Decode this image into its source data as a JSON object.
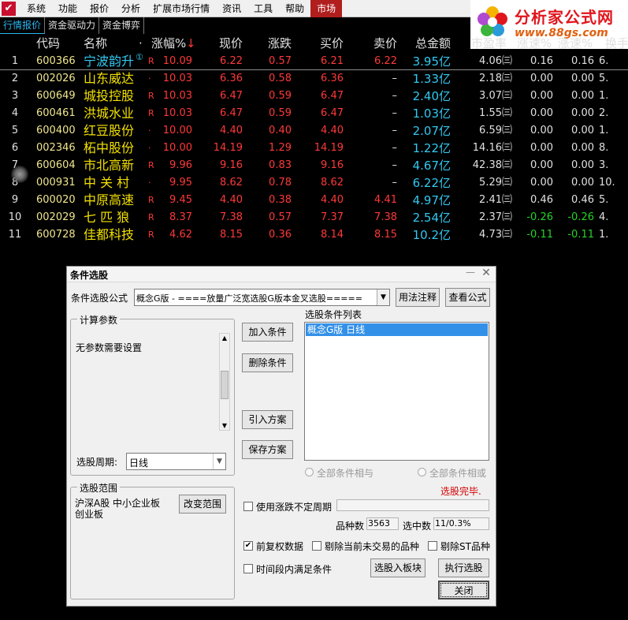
{
  "menu": {
    "app_icon": "app-logo-icon",
    "items": [
      "系统",
      "功能",
      "报价",
      "分析",
      "扩展市场行情",
      "资讯",
      "工具",
      "帮助"
    ],
    "active_item": "市场"
  },
  "logo": {
    "name": "分析家公式网",
    "url": "www.88gs.com"
  },
  "tabs": [
    "行情报价",
    "资金驱动力",
    "资金博弈"
  ],
  "table": {
    "headers": {
      "code": "代码",
      "name": "名称",
      "dot": "·",
      "chg": "涨幅%",
      "sort": "↓",
      "price": "现价",
      "diff": "涨跌",
      "bid": "买价",
      "ask": "卖价",
      "amount": "总金额",
      "pe": "市盈率",
      "s1": "涨速%",
      "s2": "涨速%",
      "turn": "换手"
    },
    "rows": [
      {
        "idx": "1",
        "code": "600366",
        "name": "宁波韵升",
        "mark": "①",
        "flag": "R",
        "chg": "10.09",
        "price": "6.22",
        "diff": "0.57",
        "bid": "6.21",
        "ask": "6.22",
        "amount": "3.95亿",
        "pe": "4.06㈢",
        "s1": "0.16",
        "s2": "0.16",
        "turn": "6."
      },
      {
        "idx": "2",
        "code": "002026",
        "name": "山东威达",
        "mark": "",
        "flag": "·",
        "chg": "10.03",
        "price": "6.36",
        "diff": "0.58",
        "bid": "6.36",
        "ask": "–",
        "amount": "1.33亿",
        "pe": "2.18㈢",
        "s1": "0.00",
        "s2": "0.00",
        "turn": "5."
      },
      {
        "idx": "3",
        "code": "600649",
        "name": "城投控股",
        "mark": "",
        "flag": "R",
        "chg": "10.03",
        "price": "6.47",
        "diff": "0.59",
        "bid": "6.47",
        "ask": "–",
        "amount": "2.40亿",
        "pe": "3.07㈢",
        "s1": "0.00",
        "s2": "0.00",
        "turn": "1."
      },
      {
        "idx": "4",
        "code": "600461",
        "name": "洪城水业",
        "mark": "",
        "flag": "R",
        "chg": "10.03",
        "price": "6.47",
        "diff": "0.59",
        "bid": "6.47",
        "ask": "–",
        "amount": "1.03亿",
        "pe": "1.55㈢",
        "s1": "0.00",
        "s2": "0.00",
        "turn": "2."
      },
      {
        "idx": "5",
        "code": "600400",
        "name": "红豆股份",
        "mark": "",
        "flag": "·",
        "chg": "10.00",
        "price": "4.40",
        "diff": "0.40",
        "bid": "4.40",
        "ask": "–",
        "amount": "2.07亿",
        "pe": "6.59㈢",
        "s1": "0.00",
        "s2": "0.00",
        "turn": "1."
      },
      {
        "idx": "6",
        "code": "002346",
        "name": "柘中股份",
        "mark": "",
        "flag": "·",
        "chg": "10.00",
        "price": "14.19",
        "diff": "1.29",
        "bid": "14.19",
        "ask": "–",
        "amount": "1.22亿",
        "pe": "14.16㈢",
        "s1": "0.00",
        "s2": "0.00",
        "turn": "8."
      },
      {
        "idx": "7",
        "code": "600604",
        "name": "市北高新",
        "mark": "",
        "flag": "R",
        "chg": "9.96",
        "price": "9.16",
        "diff": "0.83",
        "bid": "9.16",
        "ask": "–",
        "amount": "4.67亿",
        "pe": "42.38㈢",
        "s1": "0.00",
        "s2": "0.00",
        "turn": "3."
      },
      {
        "idx": "8",
        "code": "000931",
        "name": "中 关 村",
        "mark": "",
        "flag": "·",
        "chg": "9.95",
        "price": "8.62",
        "diff": "0.78",
        "bid": "8.62",
        "ask": "–",
        "amount": "6.22亿",
        "pe": "5.29㈢",
        "s1": "0.00",
        "s2": "0.00",
        "turn": "10."
      },
      {
        "idx": "9",
        "code": "600020",
        "name": "中原高速",
        "mark": "",
        "flag": "R",
        "chg": "9.45",
        "price": "4.40",
        "diff": "0.38",
        "bid": "4.40",
        "ask": "4.41",
        "amount": "4.97亿",
        "pe": "2.41㈢",
        "s1": "0.46",
        "s2": "0.46",
        "turn": "5."
      },
      {
        "idx": "10",
        "code": "002029",
        "name": "七 匹 狼",
        "mark": "",
        "flag": "R",
        "chg": "8.37",
        "price": "7.38",
        "diff": "0.57",
        "bid": "7.37",
        "ask": "7.38",
        "amount": "2.54亿",
        "pe": "2.37㈢",
        "s1": "-0.26",
        "s2": "-0.26",
        "turn": "4."
      },
      {
        "idx": "11",
        "code": "600728",
        "name": "佳都科技",
        "mark": "",
        "flag": "R",
        "chg": "4.62",
        "price": "8.15",
        "diff": "0.36",
        "bid": "8.14",
        "ask": "8.15",
        "amount": "10.2亿",
        "pe": "4.73㈢",
        "s1": "-0.11",
        "s2": "-0.11",
        "turn": "1."
      }
    ]
  },
  "dialog": {
    "title": "条件选股",
    "formula_label": "条件选股公式",
    "formula_value": "概念G版      - ====放量广泛宽选股G版本金叉选股=====",
    "usage_btn": "用法注释",
    "view_btn": "查看公式",
    "params_group": "计算参数",
    "params_text": "无参数需要设置",
    "period_label": "选股周期:",
    "period_value": "日线",
    "range_group": "选股范围",
    "range_text": "沪深A股  中小企业板\n创业板",
    "change_range_btn": "改变范围",
    "add_btn": "加入条件",
    "del_btn": "删除条件",
    "import_btn": "引入方案",
    "save_btn": "保存方案",
    "list_label": "选股条件列表",
    "list_items": [
      "概念G版   日线"
    ],
    "radio_and": "全部条件相与",
    "radio_or": "全部条件相或",
    "status": "选股完毕.",
    "use_period_label": "使用涨跌不定周期",
    "count_label": "品种数",
    "count_value": "3563",
    "selected_label": "选中数",
    "selected_value": "11/0.3%",
    "fq_label": "前复权数据",
    "fq_checked": true,
    "exclude_label": "剔除当前未交易的品种",
    "exclude_st_label": "剔除ST品种",
    "timerange_label": "时间段内满足条件",
    "to_block_btn": "选股入板块",
    "run_btn": "执行选股",
    "close_btn": "关闭"
  },
  "colors": {
    "up": "#ff3838",
    "down": "#26d426",
    "amount": "#32c8f0",
    "name": "#f2e000",
    "code": "#f0e68c"
  }
}
